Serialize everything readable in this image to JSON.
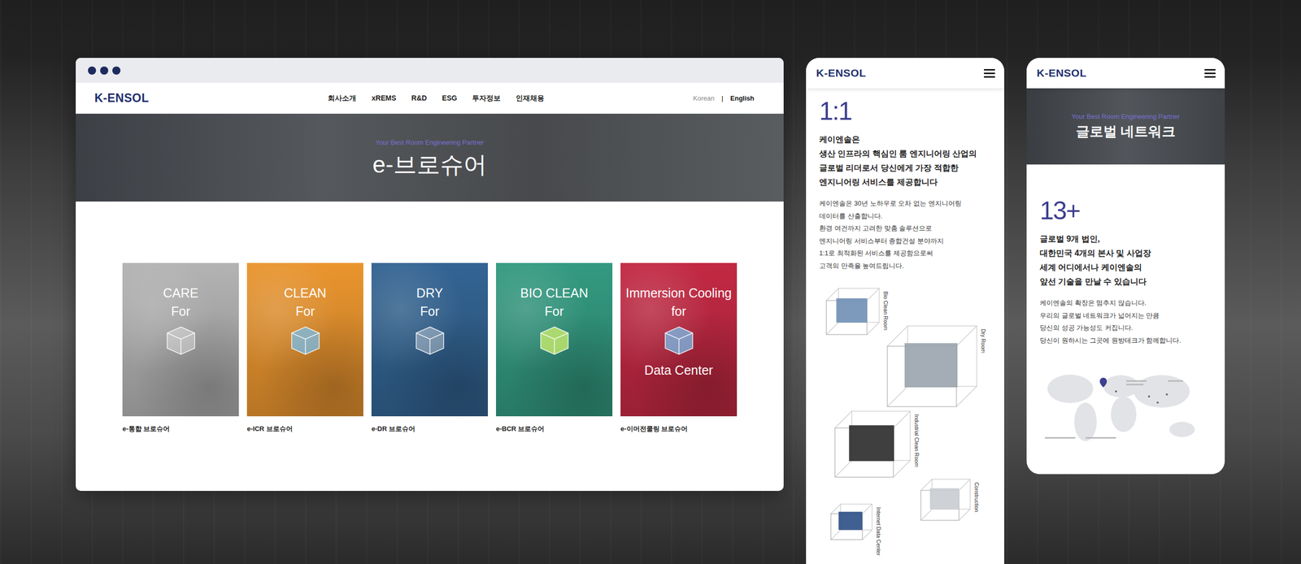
{
  "desktop": {
    "logo": "K-ENSOL",
    "nav": [
      "회사소개",
      "xREMS",
      "R&D",
      "ESG",
      "투자정보",
      "인재채용"
    ],
    "languages": [
      {
        "label": "Korean",
        "selected": false
      },
      {
        "label": "English",
        "selected": true
      }
    ],
    "language_separator": "|",
    "hero": {
      "tagline": "Your Best Room Engineering Partner",
      "title": "e-브로슈어"
    },
    "brochures": [
      {
        "title_lines": [
          "CARE",
          "For"
        ],
        "title_below": [],
        "label": "e-통합 브로슈어",
        "color": "#a6a6a6"
      },
      {
        "title_lines": [
          "CLEAN",
          "For"
        ],
        "title_below": [],
        "label": "e-ICR 브로슈어",
        "color": "#d98a2b"
      },
      {
        "title_lines": [
          "DRY",
          "For"
        ],
        "title_below": [],
        "label": "e-DR 브로슈어",
        "color": "#2f5d88"
      },
      {
        "title_lines": [
          "BIO CLEAN",
          "For"
        ],
        "title_below": [],
        "label": "e-BCR 브로슈어",
        "color": "#2f8f77"
      },
      {
        "title_lines": [
          "Immersion Cooling",
          "for"
        ],
        "title_below": [
          "Data Center"
        ],
        "label": "e-이머전쿨링 브로슈어",
        "color": "#b5263e"
      }
    ]
  },
  "mobile_about": {
    "logo": "K-ENSOL",
    "stat": "1:1",
    "heading": [
      "케이엔솔은",
      "생산 인프라의 핵심인 룸 엔지니어링 산업의",
      "글로벌 리더로서 당신에게 가장 적합한",
      "엔지니어링 서비스를 제공합니다"
    ],
    "body": [
      "케이엔솔은 30년 노하우로 오차 없는 엔지니어링",
      "데이터를 산출합니다.",
      "환경 여건까지 고려한 맞춤 솔루션으로",
      "엔지니어링 서비스부터 종합건설 분야까지",
      "1:1로 최적화된 서비스를 제공함으로써",
      "고객의 만족을 높여드립니다."
    ],
    "rooms": [
      {
        "label": "Bio Clean Room"
      },
      {
        "label": "Dry Room"
      },
      {
        "label": "Industrial Clean Room"
      },
      {
        "label": "Construction"
      },
      {
        "label": "Internet Data Center"
      }
    ]
  },
  "mobile_network": {
    "logo": "K-ENSOL",
    "hero": {
      "tagline": "Your Best Room Engineering Partner",
      "title": "글로벌 네트워크"
    },
    "stat": "13+",
    "heading": [
      "글로벌 9개 법인,",
      "대한민국 4개의 본사 및 사업장",
      "세계 어디에서나 케이엔솔의",
      "앞선 기술을 만날 수 있습니다"
    ],
    "body": [
      "케이엔솔의 확장은 멈추지 않습니다.",
      "우리의 글로벌 네트워크가 넓어지는 만큼",
      "당신의 성공 가능성도 커집니다.",
      "당신이 원하시는 그곳에 원방테크가 함께합니다."
    ]
  }
}
